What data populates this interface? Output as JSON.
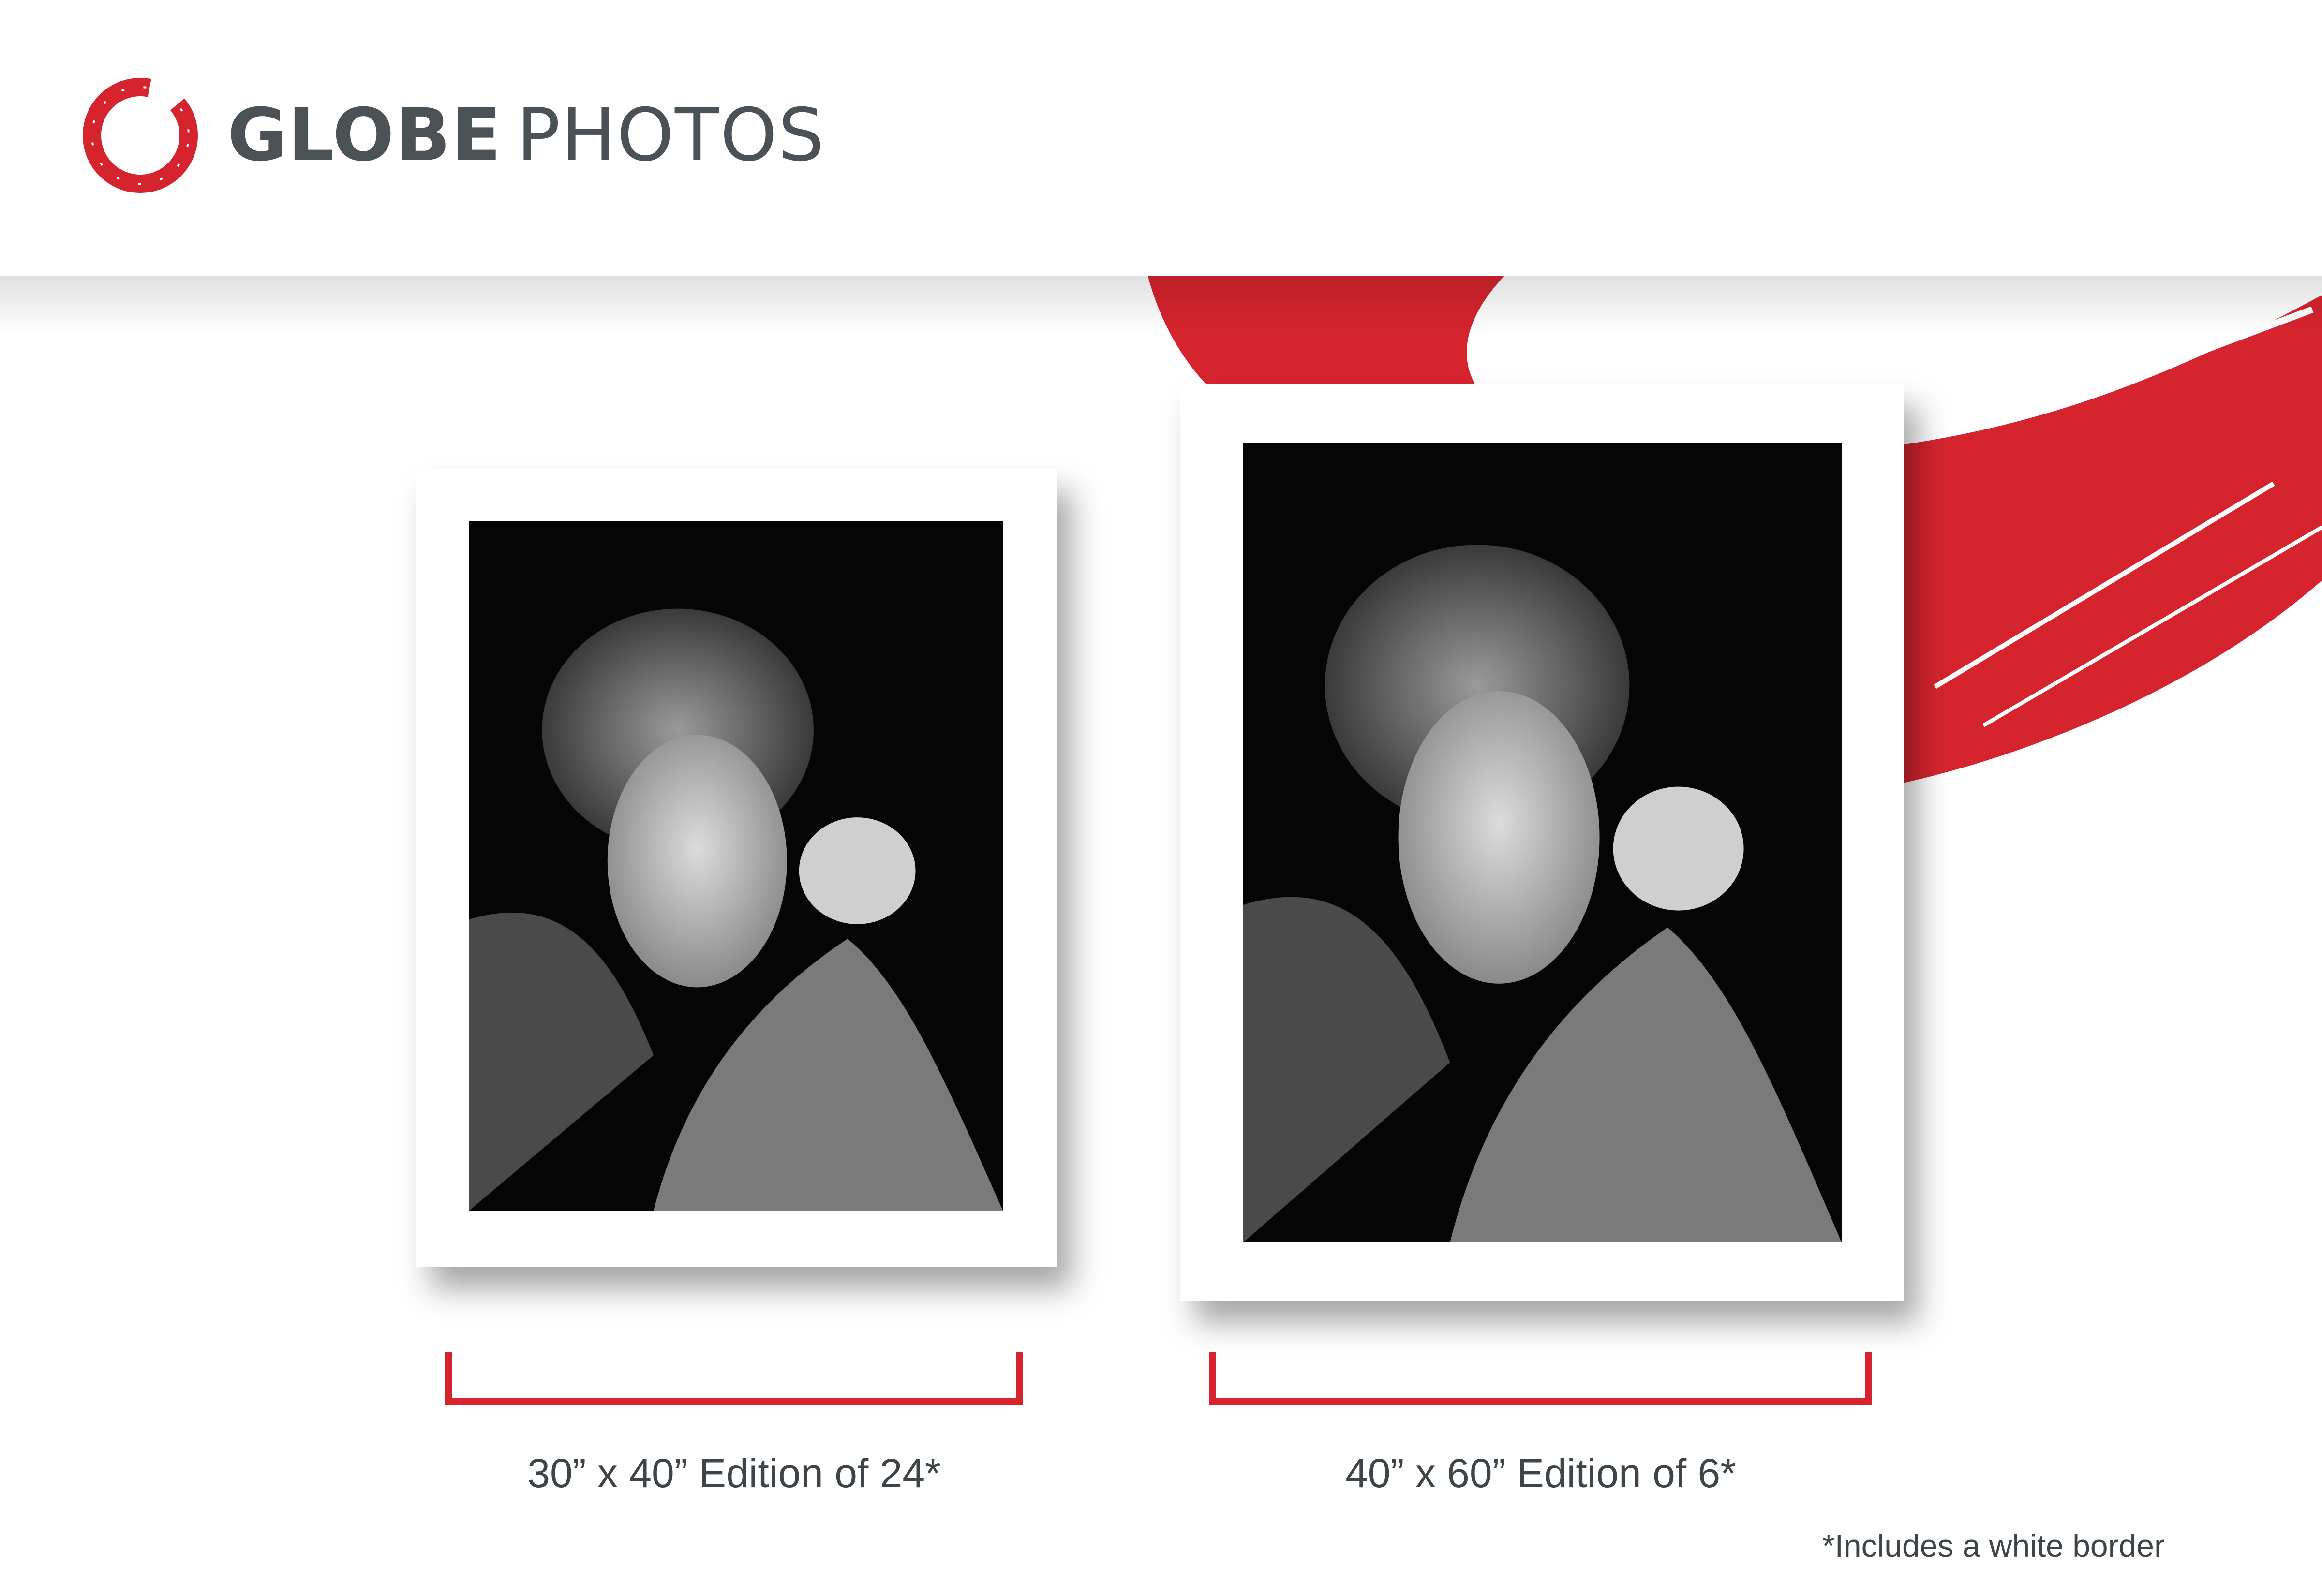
{
  "brand": {
    "name_bold": "GLOBE",
    "name_light": "PHOTOS",
    "logo_icon": "brush-circle-icon",
    "accent_color": "#d6242e",
    "text_color": "#4a5256"
  },
  "prints": [
    {
      "caption": "30” x 40” Edition of 24*",
      "size": "30” x 40”",
      "edition": "Edition of 24*"
    },
    {
      "caption": "40” x 60” Edition of 6*",
      "size": "40” x 60”",
      "edition": "Edition of 6*"
    }
  ],
  "footnote": "*Includes a white border"
}
